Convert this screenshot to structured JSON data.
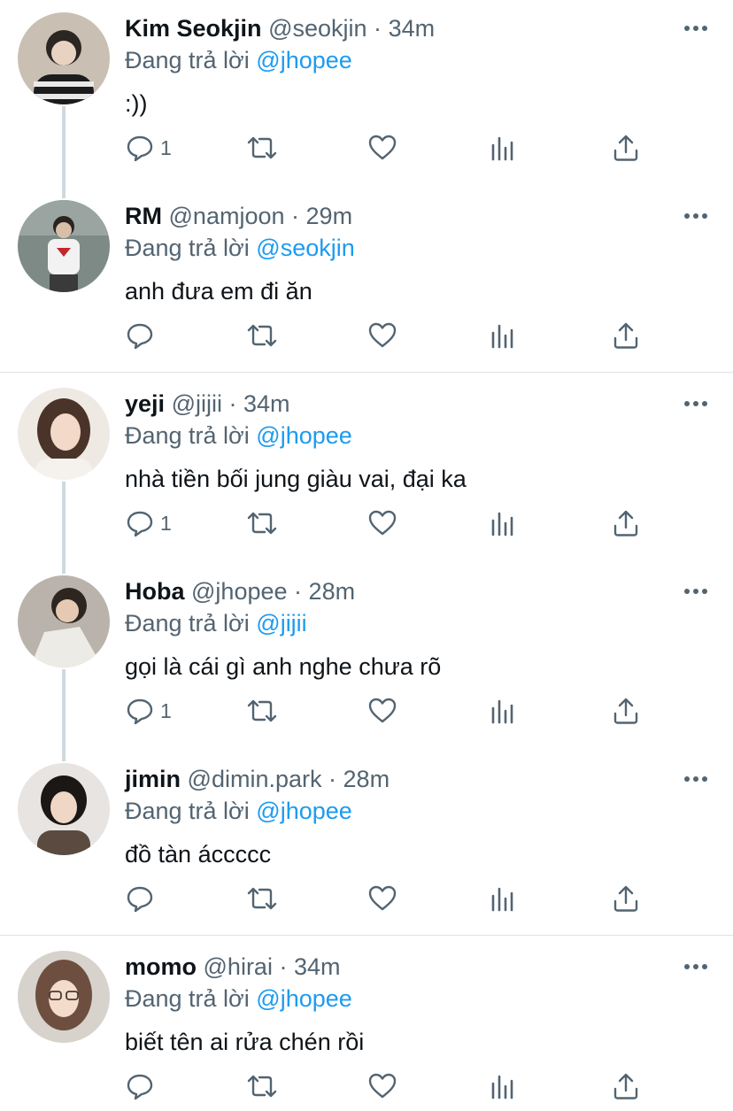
{
  "reply_prefix": "Đang trả lời",
  "tweets": [
    {
      "name": "Kim Seokjin",
      "handle": "@seokjin",
      "sep": "·",
      "time": "34m",
      "reply_to": "@jhopee",
      "text": ":))",
      "reply_count": "1"
    },
    {
      "name": "RM",
      "handle": "@namjoon",
      "sep": "·",
      "time": "29m",
      "reply_to": "@seokjin",
      "text": "anh đưa em đi ăn",
      "reply_count": ""
    },
    {
      "name": "yeji",
      "handle": "@jijii",
      "sep": "·",
      "time": "34m",
      "reply_to": "@jhopee",
      "text": "nhà tiền bối jung giàu vai, đại ka",
      "reply_count": "1"
    },
    {
      "name": "Hoba",
      "handle": "@jhopee",
      "sep": "·",
      "time": "28m",
      "reply_to": "@jijii",
      "text": "gọi là cái gì anh nghe chưa rõ",
      "reply_count": "1"
    },
    {
      "name": "jimin",
      "handle": "@dimin.park",
      "sep": "·",
      "time": "28m",
      "reply_to": "@jhopee",
      "text": "đồ tàn áccccc",
      "reply_count": ""
    },
    {
      "name": "momo",
      "handle": "@hirai",
      "sep": "·",
      "time": "34m",
      "reply_to": "@jhopee",
      "text": "biết tên ai rửa chén rồi",
      "reply_count": ""
    }
  ],
  "colors": {
    "link": "#1d9bf0",
    "muted": "#536471",
    "icon": "#536471",
    "line": "#cfd9de"
  },
  "icons": [
    "reply-icon",
    "retweet-icon",
    "like-icon",
    "stats-icon",
    "share-icon",
    "more-icon"
  ]
}
